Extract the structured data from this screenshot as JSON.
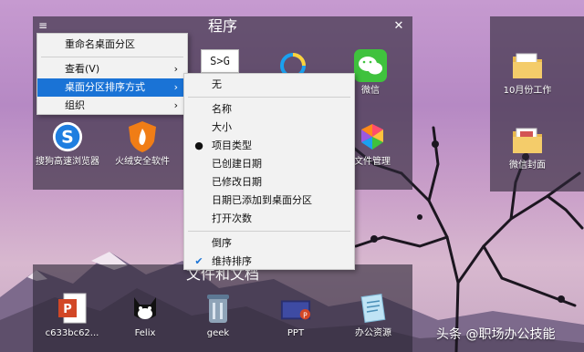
{
  "fences": {
    "programs": {
      "title": "程序",
      "icons": [
        {
          "label": "S>G",
          "icon": "sg-text-tile-icon"
        },
        {
          "label": "",
          "icon": "ring-app-icon"
        },
        {
          "label": "微信",
          "icon": "wechat-icon"
        },
        {
          "label": "搜狗高速浏览器",
          "icon": "sogou-browser-icon"
        },
        {
          "label": "火绒安全软件",
          "icon": "huorong-security-icon"
        },
        {
          "label": "文件管理",
          "icon": "file-manager-icon"
        }
      ]
    },
    "docs": {
      "title": "文件和文档",
      "icons": [
        {
          "label": "c633bc62...",
          "icon": "powerpoint-icon"
        },
        {
          "label": "Felix",
          "icon": "cat-icon"
        },
        {
          "label": "geek",
          "icon": "trash-can-icon"
        },
        {
          "label": "PPT",
          "icon": "ppt-folder-icon"
        },
        {
          "label": "办公资源",
          "icon": "notepad-icon"
        }
      ]
    },
    "right": {
      "icons": [
        {
          "label": "10月份工作",
          "icon": "folder-icon"
        },
        {
          "label": "微信封面",
          "icon": "folder-icon"
        }
      ]
    }
  },
  "main_menu": {
    "items": [
      {
        "label": "重命名桌面分区",
        "submenu": false
      },
      {
        "label": "查看(V)",
        "submenu": true
      },
      {
        "label": "桌面分区排序方式",
        "submenu": true
      },
      {
        "label": "组织",
        "submenu": true
      }
    ],
    "arrow": "›"
  },
  "sort_menu": {
    "items": [
      {
        "label": "无",
        "mark": ""
      },
      {
        "label": "名称",
        "mark": ""
      },
      {
        "label": "大小",
        "mark": ""
      },
      {
        "label": "项目类型",
        "mark": "●"
      },
      {
        "label": "已创建日期",
        "mark": ""
      },
      {
        "label": "已修改日期",
        "mark": ""
      },
      {
        "label": "日期已添加到桌面分区",
        "mark": ""
      },
      {
        "label": "打开次数",
        "mark": ""
      },
      {
        "label": "倒序",
        "mark": ""
      },
      {
        "label": "维持排序",
        "mark": "✔"
      }
    ]
  },
  "window_controls": {
    "menu_glyph": "≡",
    "close_glyph": "✕"
  },
  "watermark": "头条 @职场办公技能",
  "colors": {
    "highlight": "#1a73d6",
    "fence_bg": "#2d2637"
  }
}
